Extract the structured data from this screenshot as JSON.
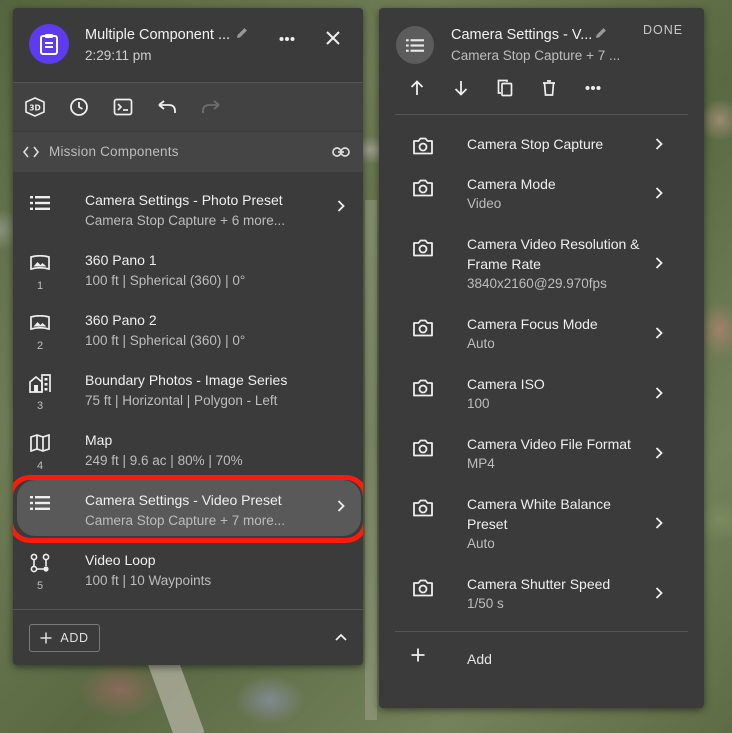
{
  "mission": {
    "title": "Multiple Component ...",
    "time": "2:29:11 pm"
  },
  "toolbar": {
    "icons": [
      "3d-view-icon",
      "clock-icon",
      "terminal-icon",
      "undo-icon",
      "redo-icon"
    ]
  },
  "components_bar": {
    "label": "Mission Components"
  },
  "components": [
    {
      "title": "Camera Settings - Photo Preset",
      "subtitle": "Camera Stop Capture + 6 more...",
      "number": "",
      "icon": "list-icon",
      "chevron": true
    },
    {
      "title": "360 Pano 1",
      "subtitle": "100 ft | Spherical (360) | 0°",
      "number": "1",
      "icon": "panorama-icon",
      "chevron": false
    },
    {
      "title": "360 Pano 2",
      "subtitle": "100 ft | Spherical (360) | 0°",
      "number": "2",
      "icon": "panorama-icon",
      "chevron": false
    },
    {
      "title": "Boundary Photos - Image Series",
      "subtitle": "75 ft | Horizontal | Polygon - Left",
      "number": "3",
      "icon": "building-icon",
      "chevron": false
    },
    {
      "title": "Map",
      "subtitle": "249 ft | 9.6 ac | 80% | 70%",
      "number": "4",
      "icon": "map-icon",
      "chevron": false
    },
    {
      "title": "Camera Settings - Video Preset",
      "subtitle": "Camera Stop Capture + 7 more...",
      "number": "",
      "icon": "list-icon",
      "chevron": true
    },
    {
      "title": "Video Loop",
      "subtitle": "100 ft | 10 Waypoints",
      "number": "5",
      "icon": "waypoints-icon",
      "chevron": false
    }
  ],
  "footer": {
    "add_label": "ADD"
  },
  "details": {
    "title": "Camera Settings - V...",
    "subtitle": "Camera Stop Capture + 7 ...",
    "done_label": "DONE",
    "add_label": "Add",
    "settings": [
      {
        "name": "Camera Stop Capture",
        "value": ""
      },
      {
        "name": "Camera Mode",
        "value": "Video"
      },
      {
        "name": "Camera Video Resolution & Frame Rate",
        "value": "3840x2160@29.970fps"
      },
      {
        "name": "Camera Focus Mode",
        "value": "Auto"
      },
      {
        "name": "Camera ISO",
        "value": "100"
      },
      {
        "name": "Camera Video File Format",
        "value": "MP4"
      },
      {
        "name": "Camera White Balance Preset",
        "value": "Auto"
      },
      {
        "name": "Camera Shutter Speed",
        "value": "1/50 s"
      }
    ]
  },
  "colors": {
    "panel": "#3b3b3b",
    "accent_avatar": "#5e3bee",
    "highlight": "#ff1a0a",
    "selected_row": "#595959"
  }
}
